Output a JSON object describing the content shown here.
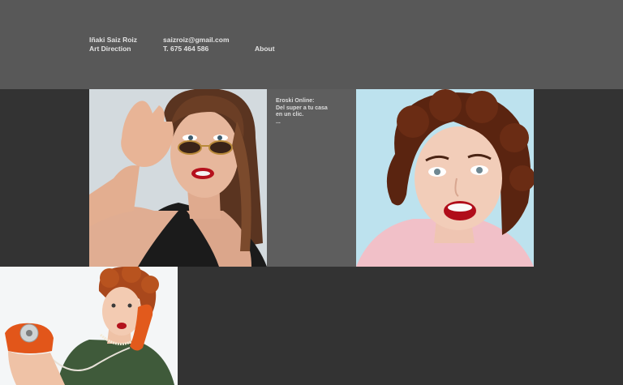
{
  "header": {
    "name": "Iñaki Saiz Roiz",
    "role": "Art Direction",
    "email": "saizroiz@gmail.com",
    "phone": "T. 675 464 586",
    "about_label": "About"
  },
  "project": {
    "title": "Eroski Online:",
    "line1": "Del super a tu casa",
    "line2": "en un clic.",
    "more": "..."
  },
  "colors": {
    "header_bg": "#585858",
    "page_bg": "#333333",
    "text_tile_bg": "#5e5e5e",
    "header_text": "#e2e2e2"
  },
  "images": [
    {
      "name": "woman-with-sunglasses",
      "icon": "photo"
    },
    {
      "name": "woman-retro-hair-smiling",
      "icon": "photo"
    },
    {
      "name": "woman-with-orange-telephone",
      "icon": "photo"
    }
  ]
}
